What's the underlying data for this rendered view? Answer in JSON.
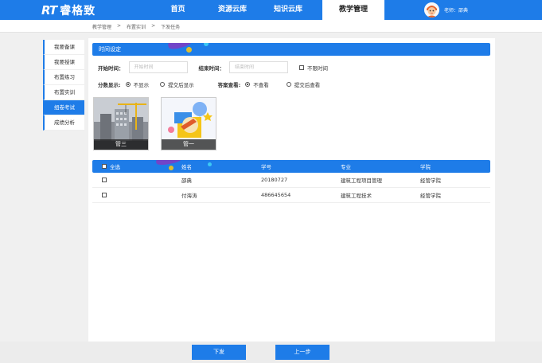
{
  "header": {
    "logo_mark": "RT",
    "logo_text": "睿格致",
    "nav": [
      "首页",
      "资源云库",
      "知识云库",
      "教学管理"
    ],
    "active_nav": "教学管理",
    "user_label": "老师：邵典"
  },
  "breadcrumb": [
    "教学管理",
    ">",
    "布置实训",
    ">",
    "下发任务"
  ],
  "sidebar": {
    "items": [
      "我要备课",
      "我要授课",
      "布置练习",
      "布置实训",
      "组卷考试",
      "成绩分析"
    ],
    "active": "组卷考试"
  },
  "time_section": {
    "title": "时间设定"
  },
  "form": {
    "start_label": "开始时间：",
    "start_placeholder": "开始时间",
    "end_label": "结束时间：",
    "end_placeholder": "结束时间",
    "no_limit_label": "不限时间",
    "score_label": "分数显示:",
    "score_opt1": "不显示",
    "score_opt2": "提交后显示",
    "answer_label": "答案查看:",
    "answer_opt1": "不查看",
    "answer_opt2": "提交后查看"
  },
  "cards": [
    {
      "caption": "管三"
    },
    {
      "caption": "管一"
    }
  ],
  "table": {
    "select_all": "全选",
    "headers": [
      "姓名",
      "学号",
      "专业",
      "学院"
    ],
    "rows": [
      [
        "邵典",
        "20180727",
        "建筑工程项目管理",
        "经管学院"
      ],
      [
        "付海涛",
        "486645654",
        "建筑工程技术",
        "经管学院"
      ]
    ]
  },
  "footer": {
    "submit": "下发",
    "prev": "上一步"
  },
  "colors": {
    "primary": "#1e7ce8",
    "accent_yellow": "#f5c518",
    "accent_purple": "#7b3fc4"
  }
}
